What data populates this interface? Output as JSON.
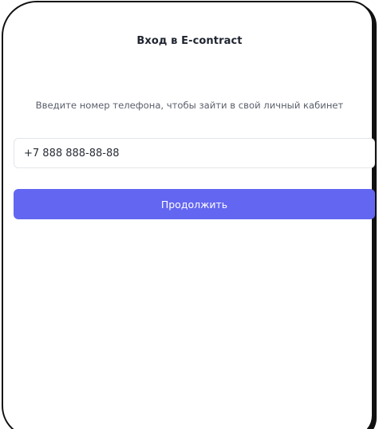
{
  "login": {
    "title": "Вход в E-contract",
    "subtitle": "Введите номер телефона, чтобы зайти в свой личный кабинет",
    "phone_value": "+7 888 888-88-88",
    "continue_label": "Продолжить"
  },
  "colors": {
    "accent": "#6366f1",
    "background": "#ffffff",
    "frame": "#111111"
  }
}
